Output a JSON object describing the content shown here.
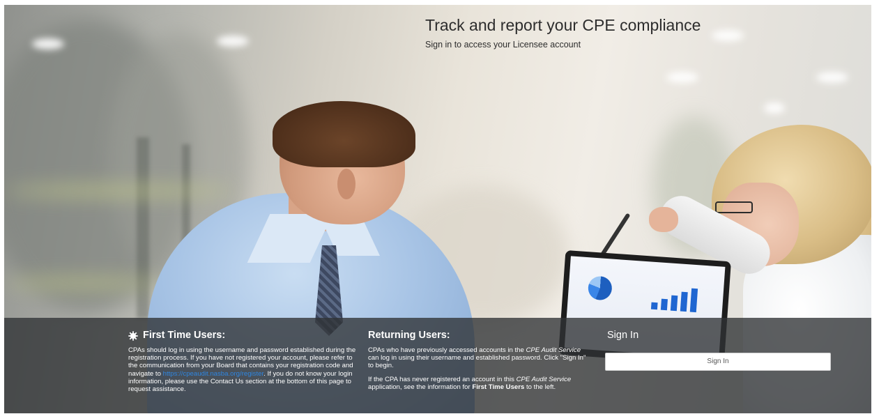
{
  "hero": {
    "title": "Track and report your CPE compliance",
    "subtitle": "Sign in to access your Licensee account"
  },
  "first_time": {
    "heading": "First Time Users:",
    "icon": "gear-icon",
    "text_before_link": "CPAs should log in using the username and password established during the registration process. If you have not registered your account, please refer to the communication from your Board that contains your registration code and navigate to ",
    "link_text": "https://cpeaudit.nasba.org/register",
    "text_after_link": ". If you do not know your login information, please use the Contact Us section at the bottom of this page to request assistance."
  },
  "returning": {
    "heading": "Returning Users:",
    "p1_a": "CPAs who have previously accessed accounts in the ",
    "p1_em": "CPE Audit Service",
    "p1_b": " can log in using their username and established password. Click \"Sign In\" to begin.",
    "p2_a": "If the CPA has never registered an account in this ",
    "p2_em": "CPE Audit Service",
    "p2_b": " application, see the information for ",
    "p2_strong": "First Time Users",
    "p2_c": " to the left."
  },
  "signin": {
    "heading": "Sign In",
    "button_label": "Sign In"
  },
  "colors": {
    "band": "#303234",
    "link": "#2f86e0",
    "button_bg": "#ffffff"
  }
}
